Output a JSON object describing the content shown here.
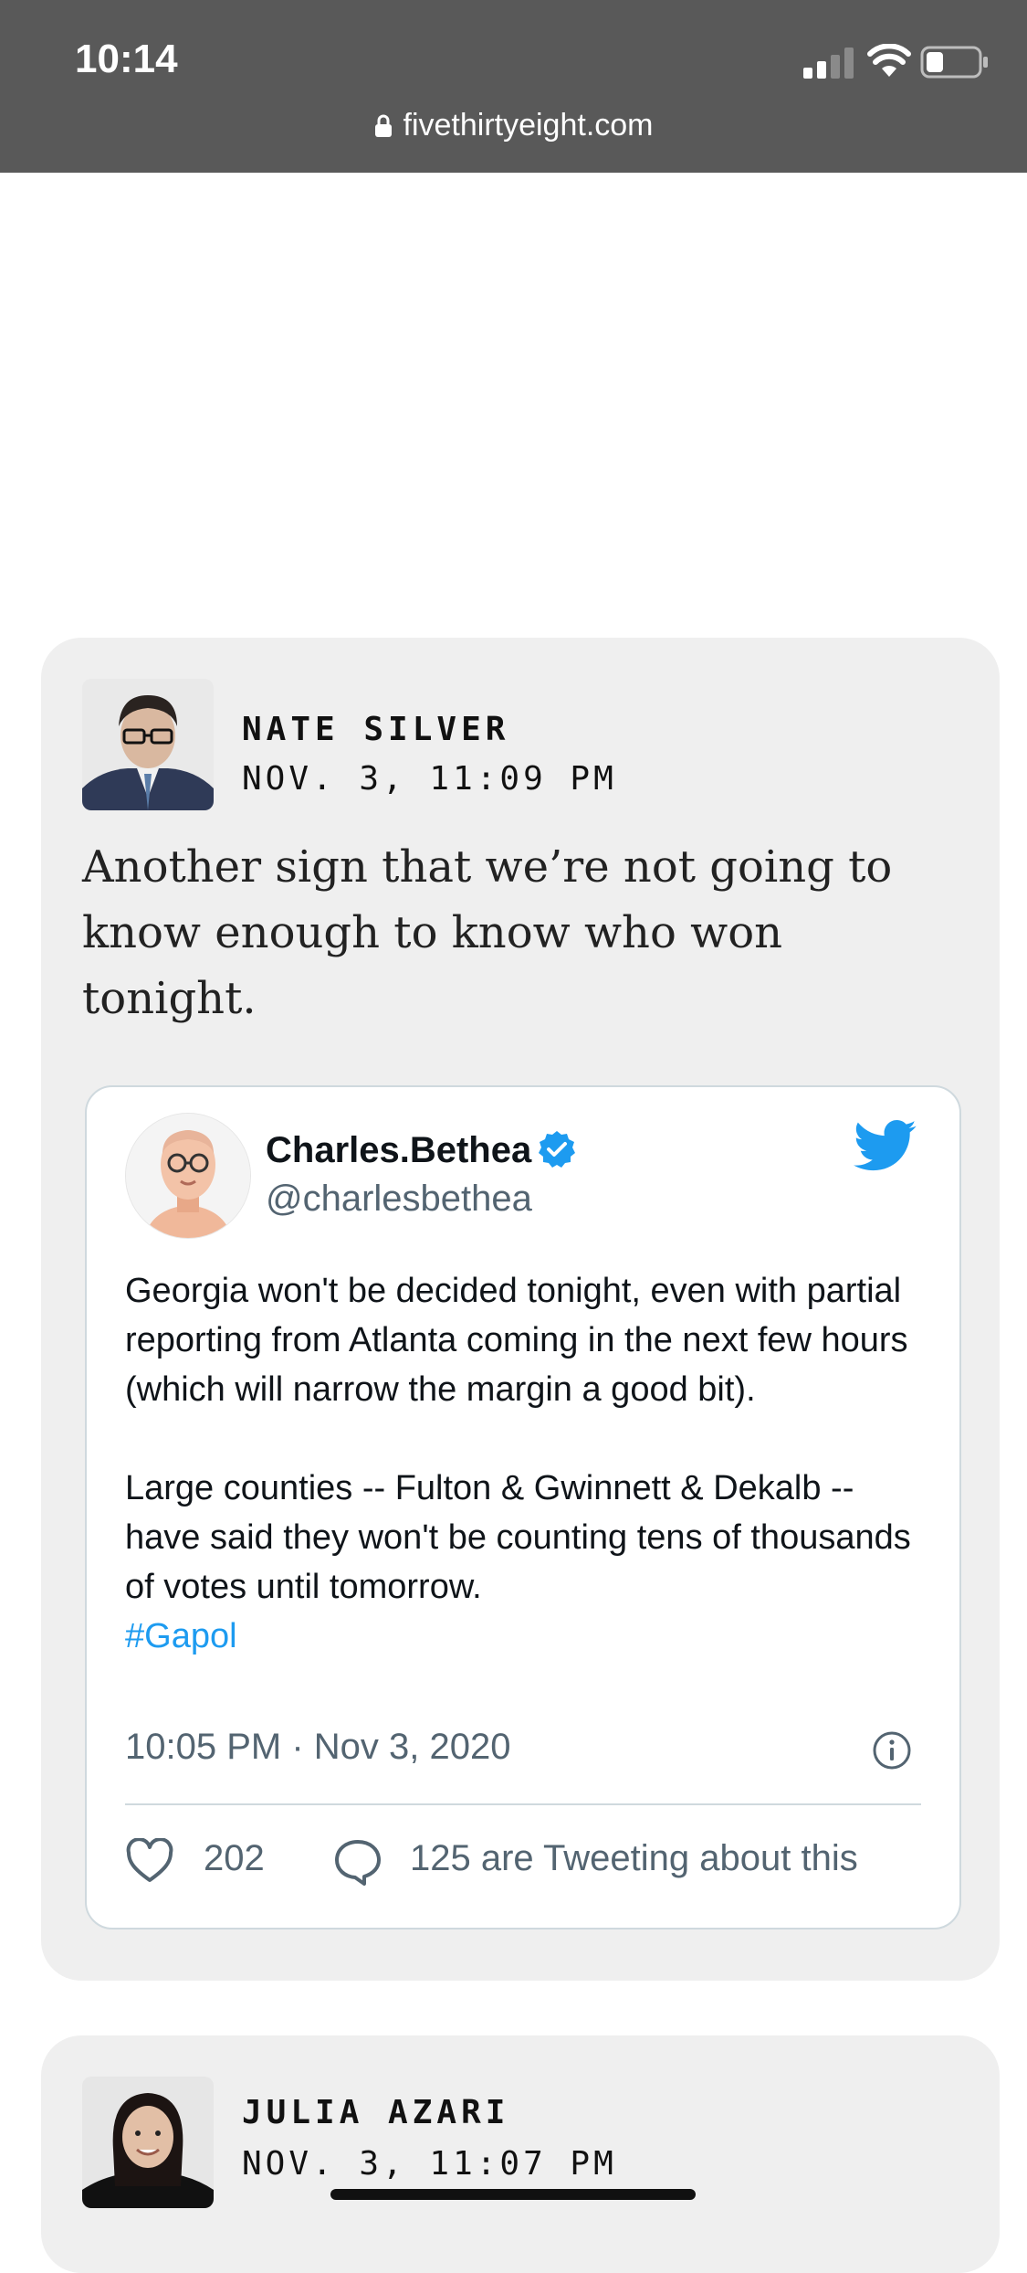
{
  "status_bar": {
    "time": "10:14",
    "url": "fivethirtyeight.com"
  },
  "posts": [
    {
      "author": "NATE SILVER",
      "timestamp": "NOV. 3, 11:09 PM",
      "text": "Another sign that we’re not going to know enough to know who won tonight.",
      "tweet": {
        "display_name": "Charles.Bethea",
        "handle": "@charlesbethea",
        "paragraph1": "Georgia won't be decided tonight, even with partial reporting from Atlanta coming in the next few hours (which will narrow the margin a good bit).",
        "paragraph2": "Large counties -- Fulton & Gwinnett & Dekalb -- have said they won't be counting tens of thousands of votes until tomorrow.",
        "hashtag": "#Gapol",
        "date": "10:05 PM · Nov 3, 2020",
        "likes": "202",
        "replies_text": "125 are Tweeting about this"
      }
    },
    {
      "author": "JULIA AZARI",
      "timestamp": "NOV. 3, 11:07 PM"
    }
  ],
  "colors": {
    "status_bar_bg": "#595959",
    "card_bg": "#efefef",
    "twitter_blue": "#1d9bf0",
    "muted_text": "#536471"
  }
}
